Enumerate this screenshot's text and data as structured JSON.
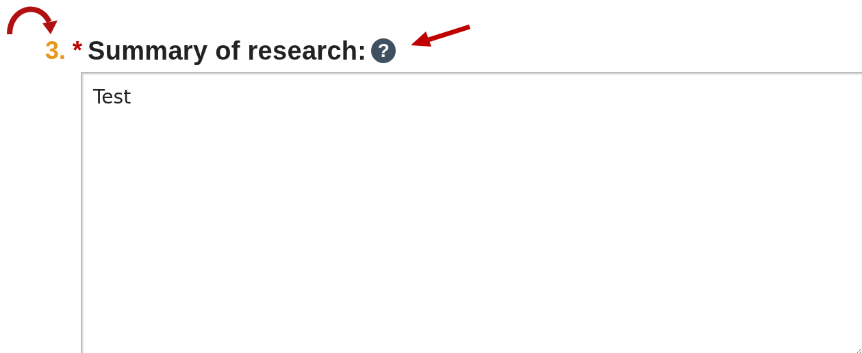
{
  "question": {
    "number": "3.",
    "required_mark": "*",
    "label": "Summary of research:",
    "help_icon": "?",
    "answer": "Test"
  },
  "annotations": [
    {
      "kind": "curved-arrow"
    },
    {
      "kind": "arrow"
    }
  ]
}
